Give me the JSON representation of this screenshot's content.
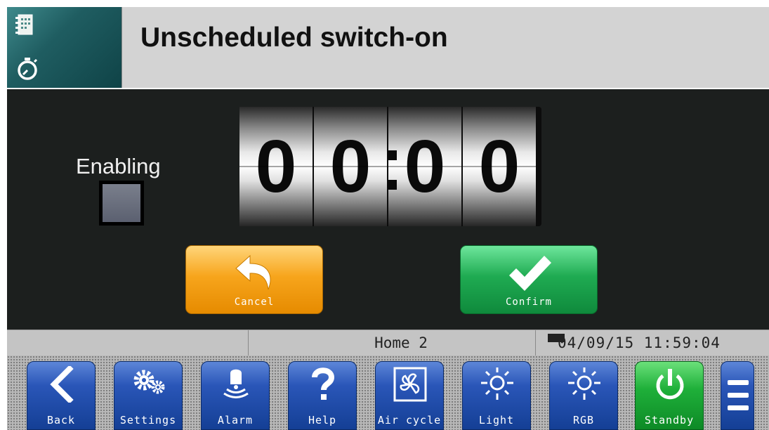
{
  "header": {
    "title": "Unscheduled switch-on"
  },
  "timer": {
    "digits": [
      "0",
      "0",
      "0",
      "0"
    ]
  },
  "enabling": {
    "label": "Enabling",
    "checked": false
  },
  "actions": {
    "cancel_label": "Cancel",
    "confirm_label": "Confirm"
  },
  "status": {
    "page": "Home 2",
    "datetime": "04/09/15 11:59:04"
  },
  "toolbar": {
    "items": [
      {
        "label": "Back",
        "icon": "back-arrow-icon"
      },
      {
        "label": "Settings",
        "icon": "gears-icon"
      },
      {
        "label": "Alarm",
        "icon": "alarm-bell-icon"
      },
      {
        "label": "Help",
        "icon": "question-mark-icon"
      },
      {
        "label": "Air cycle",
        "icon": "fan-icon"
      },
      {
        "label": "Light",
        "icon": "sun-icon"
      },
      {
        "label": "RGB",
        "icon": "sun-icon"
      },
      {
        "label": "Standby",
        "icon": "power-icon"
      }
    ],
    "menu_icon": "menu-icon"
  },
  "colors": {
    "cancel": "#f7a51c",
    "confirm": "#1fab52",
    "toolbar_button": "#2a56b8",
    "standby": "#1fb03a",
    "panel": "#1c1f1e"
  }
}
